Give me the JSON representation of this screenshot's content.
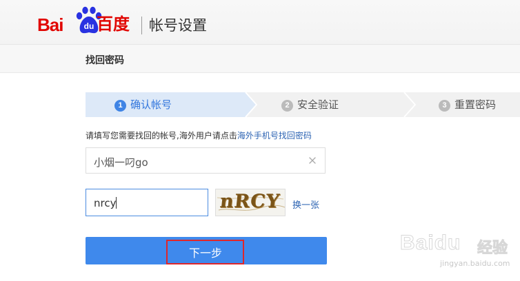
{
  "header": {
    "logo_text_latin": "Bai",
    "logo_text_paw": "du",
    "logo_text_cn": "百度",
    "title": "帐号设置",
    "brand_red": "#e10602",
    "brand_blue": "#2932e1"
  },
  "subheader": {
    "title": "找回密码"
  },
  "steps": [
    {
      "num": "1",
      "label": "确认帐号",
      "state": "active"
    },
    {
      "num": "2",
      "label": "安全验证",
      "state": "inactive"
    },
    {
      "num": "3",
      "label": "重置密码",
      "state": "inactive"
    }
  ],
  "form": {
    "hint_text": "请填写您需要找回的帐号,海外用户请点击",
    "hint_link": "海外手机号找回密码",
    "account_value": "小烟一叼go",
    "clear_icon": "close-icon",
    "captcha_value": "nrcy",
    "captcha_image_text": "nRCY",
    "refresh_label": "换一张",
    "next_label": "下一步",
    "accent": "#3f89ec",
    "link_color": "#2d64b3"
  },
  "watermark": {
    "main_latin": "Bai",
    "main_paw": "du",
    "main_cn": "经验",
    "url": "jingyan.baidu.com"
  }
}
